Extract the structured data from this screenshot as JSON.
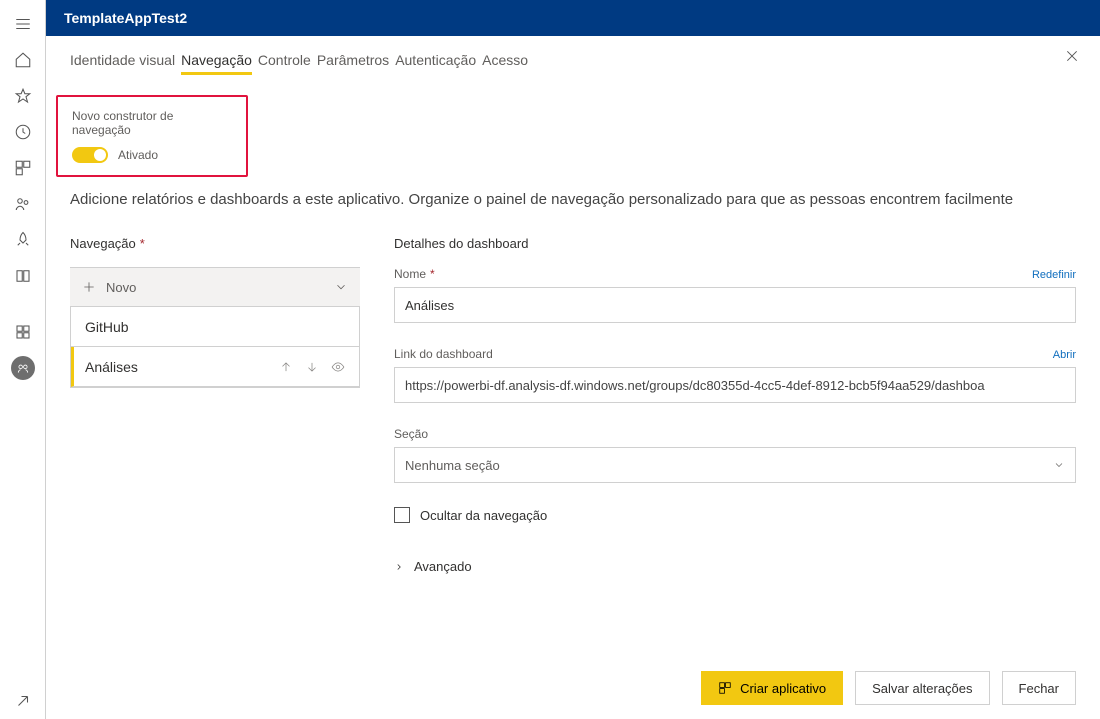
{
  "header": {
    "title": "TemplateAppTest2"
  },
  "tabs": [
    "Identidade visual",
    "Navegação",
    "Controle",
    "Parâmetros",
    "Autenticação",
    "Acesso"
  ],
  "active_tab_index": 1,
  "toggle": {
    "title": "Novo construtor de navegação",
    "state": "Ativado"
  },
  "description": "Adicione relatórios e dashboards a este aplicativo. Organize o painel de navegação personalizado para que as pessoas encontrem facilmente",
  "nav": {
    "label": "Navegação",
    "new_label": "Novo",
    "items": [
      "GitHub",
      "Análises"
    ],
    "selected_index": 1
  },
  "details": {
    "heading": "Detalhes do dashboard",
    "name": {
      "label": "Nome",
      "value": "Análises",
      "reset": "Redefinir"
    },
    "link": {
      "label": "Link do dashboard",
      "value": "https://powerbi-df.analysis-df.windows.net/groups/dc80355d-4cc5-4def-8912-bcb5f94aa529/dashboa",
      "open": "Abrir"
    },
    "section": {
      "label": "Seção",
      "value": "Nenhuma seção"
    },
    "hide": {
      "label": "Ocultar da navegação"
    },
    "advanced": {
      "label": "Avançado"
    }
  },
  "footer": {
    "create": "Criar aplicativo",
    "save": "Salvar alterações",
    "close": "Fechar"
  }
}
